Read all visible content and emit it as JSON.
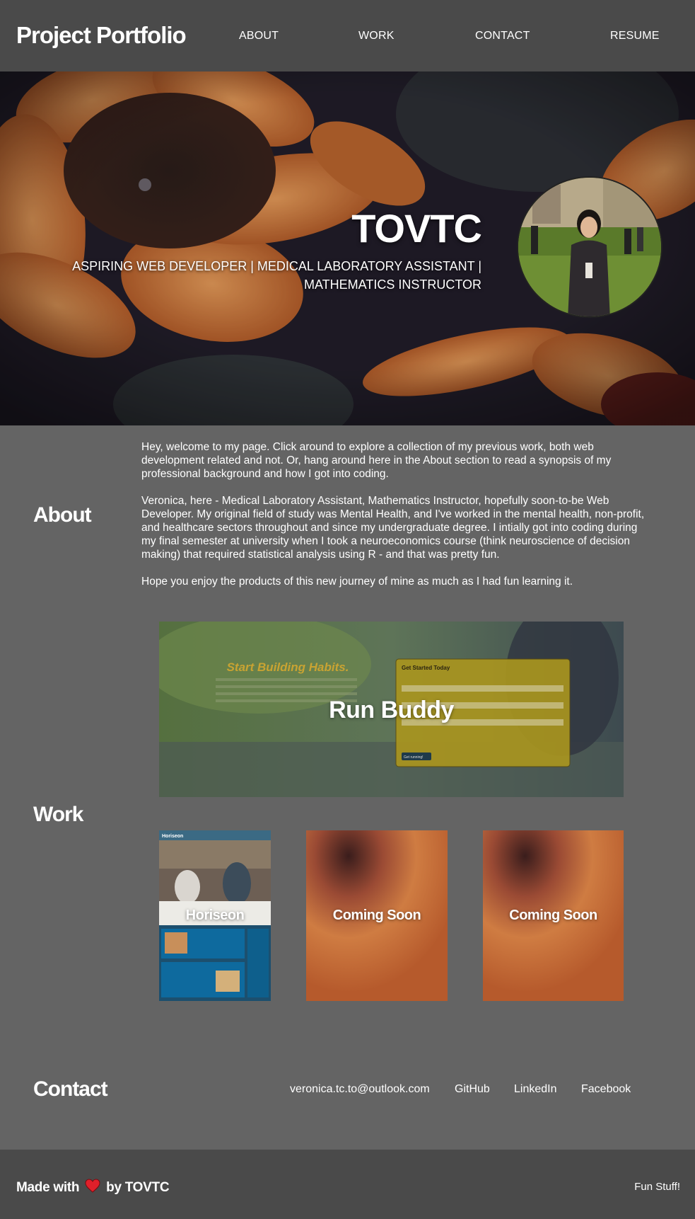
{
  "header": {
    "brand": "Project Portfolio",
    "nav": [
      "ABOUT",
      "WORK",
      "CONTACT",
      "RESUME"
    ]
  },
  "hero": {
    "name": "TOVTC",
    "tagline_line1": "ASPIRING WEB DEVELOPER | MEDICAL LABORATORY ASSISTANT |",
    "tagline_line2": "MATHEMATICS INSTRUCTOR"
  },
  "about": {
    "title": "About",
    "paragraphs": [
      "Hey, welcome to my page. Click around to explore a collection of my previous work, both web development related and not. Or, hang around here in the About section to read a synopsis of my professional background and how I got into coding.",
      "Veronica, here - Medical Laboratory Assistant, Mathematics Instructor, hopefully soon-to-be Web Developer. My original field of study was Mental Health, and I've worked in the mental health, non-profit, and healthcare sectors throughout and since my undergraduate degree. I intially got into coding during my final semester at university when I took a neuroeconomics course (think neuroscience of decision making) that required statistical analysis using R - and that was pretty fun.",
      "Hope you enjoy the products of this new journey of mine as much as I had fun learning it."
    ]
  },
  "work": {
    "title": "Work",
    "featured": {
      "label": "Run Buddy",
      "screenshot_heading": "Start Building Habits.",
      "form_title": "Get Started Today",
      "form_button": "Get running!"
    },
    "projects": [
      {
        "label": "Horiseon",
        "screenshot_brand": "Horiseon"
      },
      {
        "label": "Coming Soon"
      },
      {
        "label": "Coming Soon"
      }
    ]
  },
  "contact": {
    "title": "Contact",
    "links": [
      "veronica.tc.to@outlook.com",
      "GitHub",
      "LinkedIn",
      "Facebook"
    ]
  },
  "footer": {
    "made_prefix": "Made with",
    "made_suffix": "by TOVTC",
    "fun_link": "Fun Stuff!",
    "heart_color": "#e0202a"
  }
}
